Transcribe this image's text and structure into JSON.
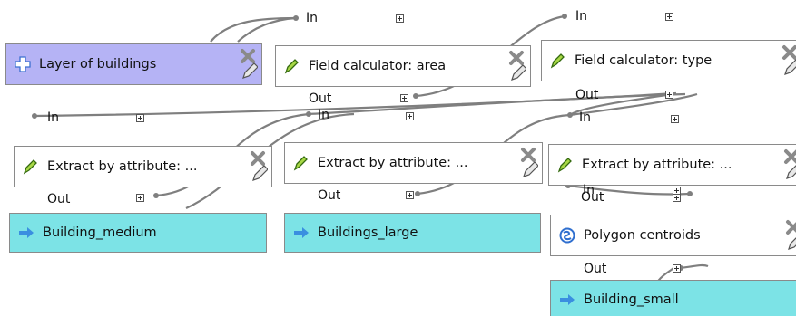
{
  "colors": {
    "input_node": "#b5b3f5",
    "output_node": "#7ce3e6",
    "algorithm_node": "#ffffff",
    "wire": "#7f7f7f"
  },
  "ports": {
    "in": "In",
    "out": "Out"
  },
  "nodes": {
    "layer_of_buildings": {
      "label": "Layer of buildings",
      "icon": "plus-icon"
    },
    "field_calc_area": {
      "label": "Field calculator: area",
      "icon": "pencil-algorithm-icon"
    },
    "field_calc_type": {
      "label": "Field calculator: type",
      "icon": "pencil-algorithm-icon"
    },
    "extract_1": {
      "label": "Extract by attribute: ...",
      "icon": "pencil-algorithm-icon"
    },
    "extract_2": {
      "label": "Extract by attribute: ...",
      "icon": "pencil-algorithm-icon"
    },
    "extract_3": {
      "label": "Extract by attribute: ...",
      "icon": "pencil-algorithm-icon"
    },
    "polygon_centroids": {
      "label": "Polygon centroids",
      "icon": "qgis-algorithm-icon"
    },
    "building_medium": {
      "label": "Building_medium",
      "icon": "arrow-right-icon"
    },
    "buildings_large": {
      "label": "Buildings_large",
      "icon": "arrow-right-icon"
    },
    "building_small": {
      "label": "Building_small",
      "icon": "arrow-right-icon"
    }
  }
}
